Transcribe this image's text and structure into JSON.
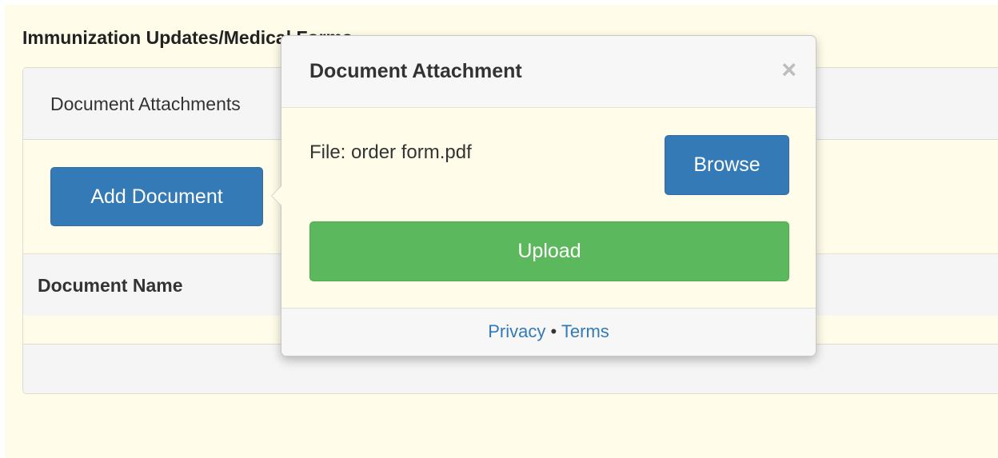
{
  "section": {
    "title": "Immunization Updates/Medical Forms"
  },
  "panel": {
    "heading": "Document Attachments",
    "add_button": "Add Document",
    "table": {
      "columns": [
        "Document Name"
      ]
    }
  },
  "popover": {
    "title": "Document Attachment",
    "close_glyph": "×",
    "file_label": "File: order form.pdf",
    "browse_button": "Browse",
    "upload_button": "Upload",
    "footer": {
      "privacy": "Privacy",
      "separator": "•",
      "terms": "Terms"
    }
  },
  "colors": {
    "page_bg": "#fffde9",
    "primary": "#337ab7",
    "success": "#5cb85c"
  }
}
